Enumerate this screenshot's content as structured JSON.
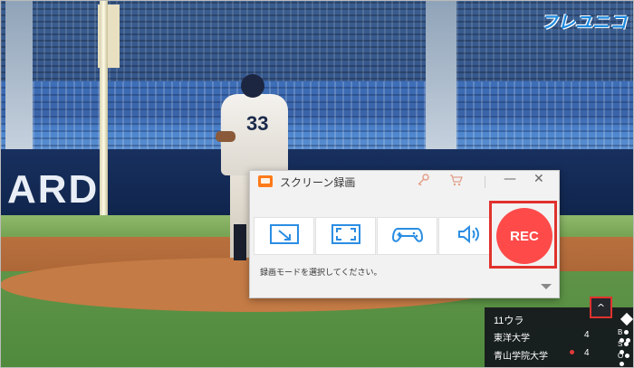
{
  "watermark": {
    "logo_text": "フレユニコ"
  },
  "background": {
    "wall_text": "ARD",
    "pitcher_number": "33"
  },
  "recorder": {
    "title": "スクリーン録画",
    "icons": {
      "app": "screen-record-app-icon",
      "key": "key-icon",
      "cart": "cart-icon",
      "minimize": "minimize-icon",
      "close": "close-icon"
    },
    "minimize_label": "—",
    "close_label": "✕",
    "modes": [
      {
        "name": "region-mode",
        "icon": "region-select-icon"
      },
      {
        "name": "fullscreen-mode",
        "icon": "fullscreen-icon"
      },
      {
        "name": "game-mode",
        "icon": "gamepad-icon"
      },
      {
        "name": "audio-mode",
        "icon": "speaker-icon"
      }
    ],
    "rec_label": "REC",
    "hint": "録画モードを選択してください。",
    "accent": "#ff4a4a",
    "highlight": "#e0322d"
  },
  "scoreboard": {
    "inning": "11ウラ",
    "teams": [
      {
        "name": "東洋大学",
        "score": "4"
      },
      {
        "name": "青山学院大学",
        "score": "4"
      }
    ],
    "bso_labels": [
      "B",
      "S",
      "O"
    ],
    "collapse_label": "^"
  }
}
